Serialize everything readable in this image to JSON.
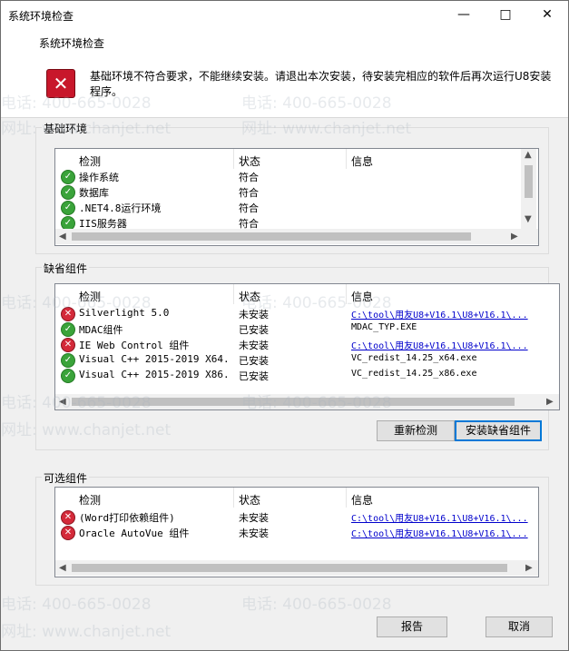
{
  "window": {
    "title": "系统环境检查",
    "minimize_icon": "minimize-icon",
    "maximize_icon": "maximize-icon",
    "close_icon": "close-icon"
  },
  "header": {
    "title": "系统环境检查",
    "error_icon": "error-icon",
    "message": "基础环境不符合要求，不能继续安装。请退出本次安装，待安装完相应的软件后再次运行U8安装程序。"
  },
  "columns": {
    "check": "检测",
    "status": "状态",
    "info": "信息"
  },
  "basic": {
    "title": "基础环境",
    "rows": [
      {
        "name": "操作系统",
        "status": "符合",
        "info": "",
        "ok": true
      },
      {
        "name": "数据库",
        "status": "符合",
        "info": "",
        "ok": true
      },
      {
        "name": ".NET4.8运行环境",
        "status": "符合",
        "info": "",
        "ok": true
      },
      {
        "name": "IIS服务器",
        "status": "符合",
        "info": "",
        "ok": true
      }
    ]
  },
  "missing": {
    "title": "缺省组件",
    "rows": [
      {
        "name": "Silverlight 5.0",
        "status": "未安装",
        "info": "C:\\tool\\用友U8+V16.1\\U8+V16.1\\...",
        "ok": false,
        "link": true
      },
      {
        "name": "MDAC组件",
        "status": "已安装",
        "info": "MDAC_TYP.EXE",
        "ok": true,
        "link": false
      },
      {
        "name": "IE Web Control 组件",
        "status": "未安装",
        "info": "C:\\tool\\用友U8+V16.1\\U8+V16.1\\...",
        "ok": false,
        "link": true
      },
      {
        "name": "Visual C++ 2015-2019 X64...",
        "status": "已安装",
        "info": "VC_redist_14.25_x64.exe",
        "ok": true,
        "link": false
      },
      {
        "name": "Visual C++ 2015-2019 X86...",
        "status": "已安装",
        "info": "VC_redist_14.25_x86.exe",
        "ok": true,
        "link": false
      }
    ],
    "recheck_label": "重新检测",
    "install_label": "安装缺省组件"
  },
  "optional": {
    "title": "可选组件",
    "rows": [
      {
        "name": "(Word打印依赖组件)",
        "status": "未安装",
        "info": "C:\\tool\\用友U8+V16.1\\U8+V16.1\\...",
        "ok": false,
        "link": true
      },
      {
        "name": "Oracle AutoVue 组件",
        "status": "未安装",
        "info": "C:\\tool\\用友U8+V16.1\\U8+V16.1\\...",
        "ok": false,
        "link": true
      }
    ]
  },
  "footer": {
    "report_label": "报告",
    "cancel_label": "取消"
  },
  "watermarks": {
    "phone": "电话: 400-665-0028",
    "site": "网址: www.chanjet.net"
  }
}
